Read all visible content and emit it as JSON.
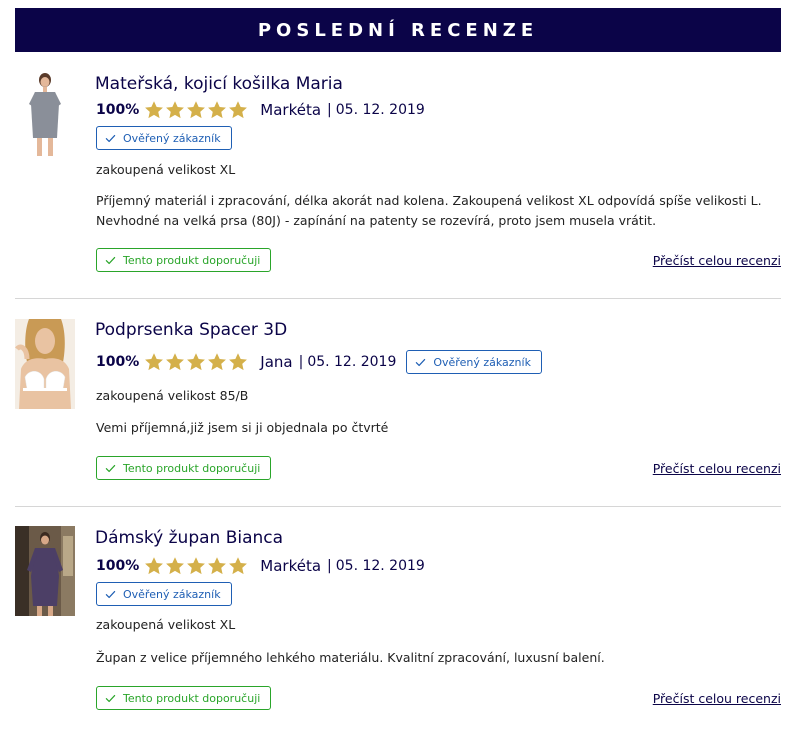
{
  "header": {
    "title": "POSLEDNÍ RECENZE"
  },
  "labels": {
    "verified": "Ověřený zákazník",
    "recommend": "Tento produkt doporučuji",
    "read_more": "Přečíst celou recenzi",
    "separator": "|"
  },
  "colors": {
    "brand": "#0b0448",
    "star": "#d4b04a",
    "verified": "#1f5fb4",
    "recommend": "#2aa52a"
  },
  "reviews": [
    {
      "product": "Mateřská, kojicí košilka Maria",
      "rating_pct": "100%",
      "stars": 5,
      "author": "Markéta",
      "date": "05. 12. 2019",
      "size": "zakoupená velikost XL",
      "text": "Příjemný materiál i zpracování, délka akorát nad kolena. Zakoupená velikost XL odpovídá spíše velikosti L. Nevhodné na velká prsa (80J) - zapínání na patenty se rozevírá, proto jsem musela vrátit."
    },
    {
      "product": "Podprsenka Spacer 3D",
      "rating_pct": "100%",
      "stars": 5,
      "author": "Jana",
      "date": "05. 12. 2019",
      "size": "zakoupená velikost 85/B",
      "text": "Vemi příjemná,již jsem si ji objednala po čtvrté"
    },
    {
      "product": "Dámský župan Bianca",
      "rating_pct": "100%",
      "stars": 5,
      "author": "Markéta",
      "date": "05. 12. 2019",
      "size": "zakoupená velikost XL",
      "text": "Župan z velice příjemného lehkého materiálu. Kvalitní zpracování, luxusní balení."
    }
  ]
}
